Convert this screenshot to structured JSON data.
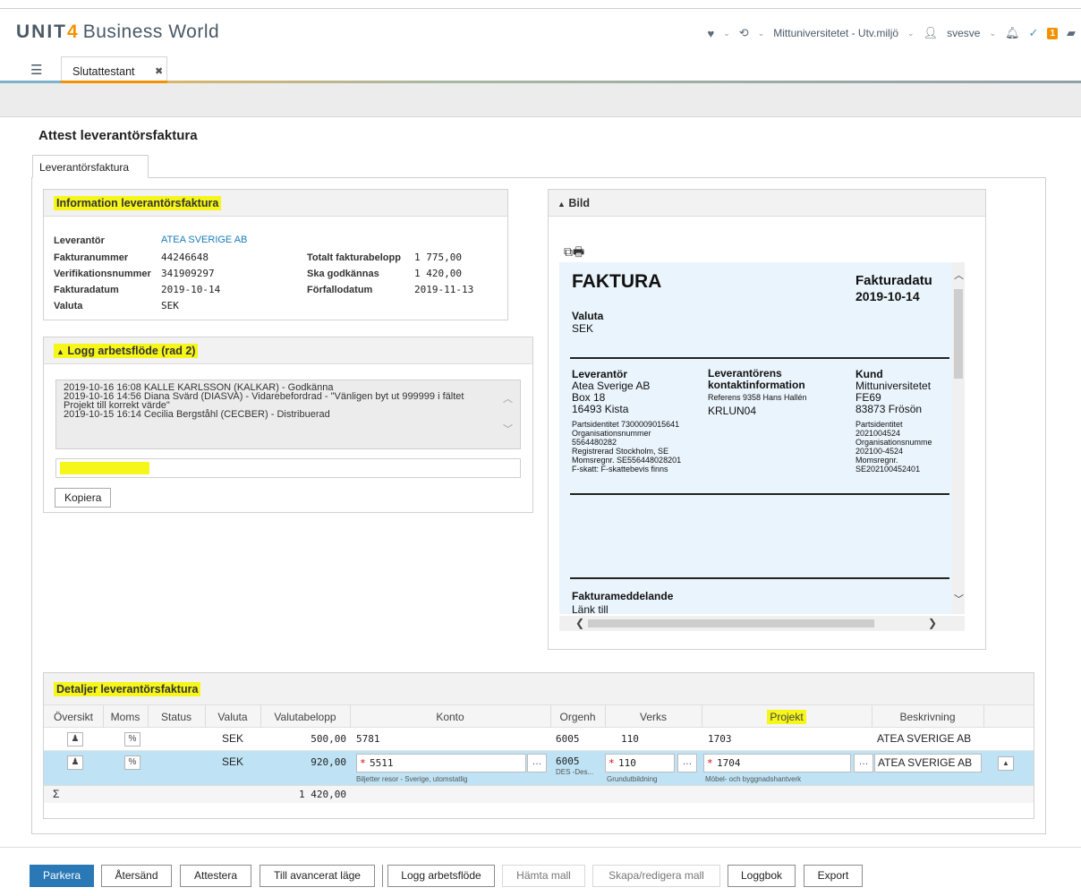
{
  "header": {
    "logo_brand": "UNIT",
    "logo_four": "4",
    "logo_product": "Business World",
    "environment": "Mittuniversitetet - Utv.miljö",
    "user": "svesve",
    "notification_count": "1",
    "icons": [
      "heart-icon",
      "history-icon",
      "user-icon",
      "bell-icon",
      "check-icon",
      "chat-icon"
    ]
  },
  "tabs": {
    "app_tab": "Slutattestant"
  },
  "page": {
    "title": "Attest leverantörsfaktura",
    "doc_tab": "Leverantörsfaktura"
  },
  "info": {
    "title": "Information leverantörsfaktura",
    "labels": {
      "supplier": "Leverantör",
      "invoice_number": "Fakturanummer",
      "voucher_number": "Verifikationsnummer",
      "invoice_date": "Fakturadatum",
      "currency": "Valuta",
      "total": "Totalt fakturabelopp",
      "to_approve": "Ska godkännas",
      "due_date": "Förfallodatum"
    },
    "values": {
      "supplier": "ATEA SVERIGE AB",
      "invoice_number": "44246648",
      "voucher_number": "341909297",
      "invoice_date": "2019-10-14",
      "currency": "SEK",
      "total": "1 775,00",
      "to_approve": "1 420,00",
      "due_date": "2019-11-13"
    }
  },
  "log": {
    "title": "Logg arbetsflöde (rad 2)",
    "lines": [
      "2019-10-16 16:08 KALLE KARLSSON (KALKAR) - Godkänna",
      "2019-10-16 14:56 Diana Svärd (DIASVA) - Vidarebefordrad - \"Vänligen byt ut 999999 i fältet",
      "Projekt till korrekt värde\"",
      "2019-10-15 16:14 Cecilia Bergståhl (CECBER) - Distribuerad"
    ],
    "copy_button": "Kopiera"
  },
  "image": {
    "title": "Bild",
    "invoice": {
      "heading": "FAKTURA",
      "date_label": "Fakturadatu",
      "date_value": "2019-10-14",
      "currency_label": "Valuta",
      "currency_value": "SEK",
      "supplier_label": "Leverantör",
      "supplier_lines": [
        "Atea Sverige AB",
        "Box 18",
        "16493  Kista"
      ],
      "supplier_small": [
        "Partsidentitet  7300009015641",
        "Organisationsnummer",
        " 5564480282",
        "Registrerad  Stockholm,  SE",
        "Momsregnr.  SE556448028201",
        "F-skatt:  F-skattebevis finns"
      ],
      "contact_label_1": "Leverantörens",
      "contact_label_2": "kontaktinformation",
      "contact_ref": "Referens  9358 Hans Hallén",
      "contact_code": "KRLUN04",
      "customer_label": "Kund",
      "customer_lines": [
        "Mittuniversitetet",
        "FE69",
        "83873  Frösön"
      ],
      "customer_small": [
        "Partsidentitet",
        " 2021004524",
        "Organisationsnumme",
        " 202100-4524",
        "Momsregnr.",
        " SE202100452401"
      ],
      "message_label": "Fakturameddelande",
      "message_value": "Länk till"
    }
  },
  "details": {
    "title": "Detaljer leverantörsfaktura",
    "columns": [
      "Översikt",
      "Moms",
      "Status",
      "Valuta",
      "Valutabelopp",
      "Konto",
      "Orgenh",
      "Verks",
      "Projekt",
      "Beskrivning"
    ],
    "rows": [
      {
        "currency": "SEK",
        "amount": "500,00",
        "account": "5781",
        "org": "6005",
        "verks": "110",
        "project": "1703",
        "description": "ATEA SVERIGE AB"
      },
      {
        "currency": "SEK",
        "amount": "920,00",
        "account": "5511",
        "account_desc": "Biljetter resor - Sverige, utomstatlig",
        "org": "6005",
        "org_desc": "DES -Des...",
        "verks": "110",
        "verks_desc": "Grundutbildning",
        "project": "1704",
        "project_desc": "Möbel- och byggnadshantverk",
        "description": "ATEA SVERIGE AB"
      }
    ],
    "sum_symbol": "Σ",
    "sum_value": "1 420,00",
    "overview_icon": "♟",
    "moms_icon": "%"
  },
  "toolbar": {
    "buttons": [
      "Parkera",
      "Återsänd",
      "Attestera",
      "Till avancerat läge",
      "Logg arbetsflöde",
      "Hämta mall",
      "Skapa/redigera mall",
      "Loggbok",
      "Export"
    ]
  },
  "colors": {
    "accent": "#f39200",
    "primary": "#2a78b5",
    "highlight": "#f6f61a",
    "selected_row": "#bfe3f4"
  }
}
